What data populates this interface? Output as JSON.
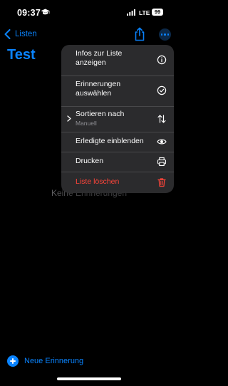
{
  "status_bar": {
    "time": "09:37",
    "network": "LTE",
    "battery": "99"
  },
  "nav": {
    "back_label": "Listen"
  },
  "list": {
    "title": "Test",
    "empty_text": "Keine Erinnerungen"
  },
  "menu": {
    "items": [
      {
        "label": "Infos zur Liste anzeigen",
        "icon": "info-icon"
      },
      {
        "label": "Erinnerungen auswählen",
        "icon": "checkmark-circle-icon"
      },
      {
        "label": "Sortieren nach",
        "sublabel": "Manuell",
        "icon": "sort-arrows-icon"
      },
      {
        "label": "Erledigte einblenden",
        "icon": "eye-icon"
      },
      {
        "label": "Drucken",
        "icon": "printer-icon"
      },
      {
        "label": "Liste löschen",
        "icon": "trash-icon",
        "destructive": true
      }
    ]
  },
  "footer": {
    "new_reminder_label": "Neue Erinnerung"
  },
  "colors": {
    "accent": "#0a84ff",
    "destructive": "#ff453a",
    "background": "#000000",
    "menu_background": "#2c2c2e"
  }
}
